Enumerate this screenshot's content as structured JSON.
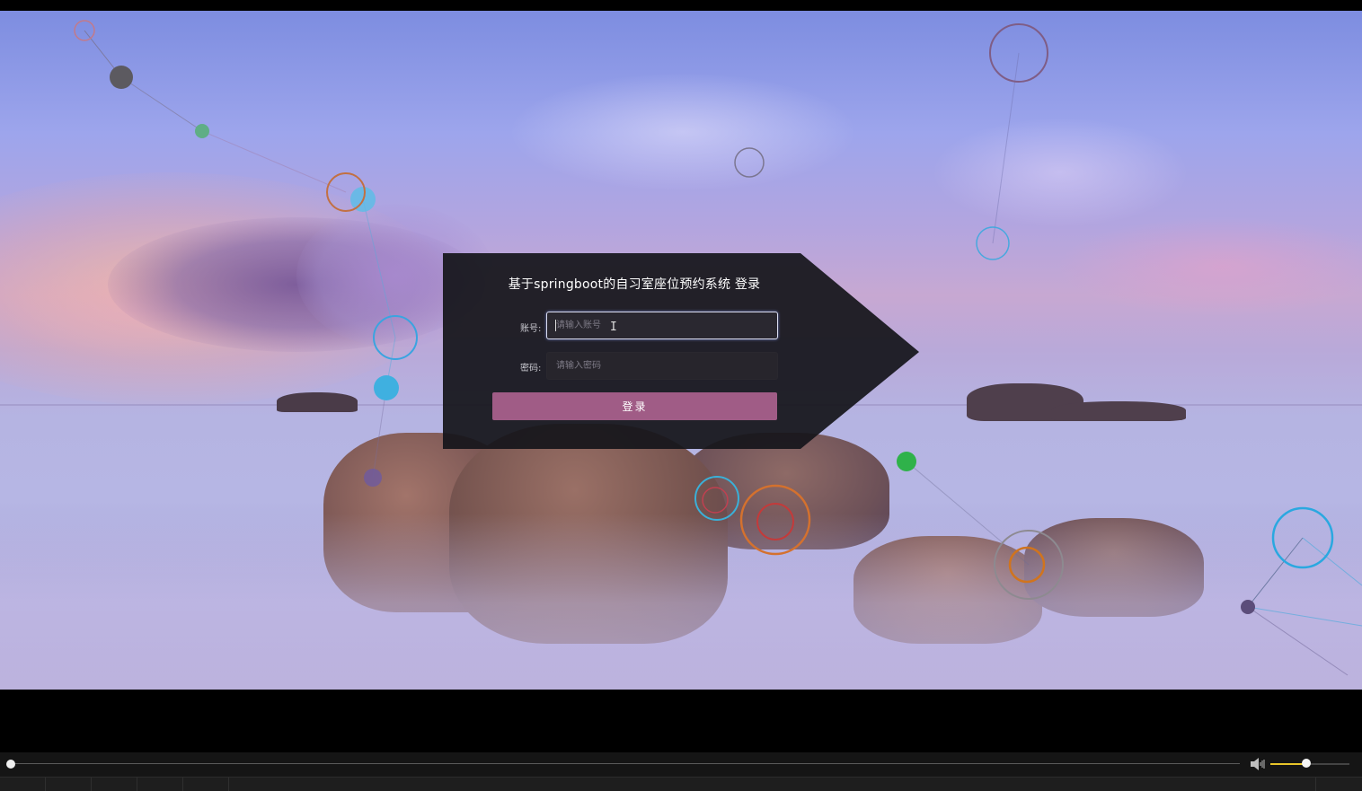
{
  "login": {
    "title": "基于springboot的自习室座位预约系统 登录",
    "account_label": "账号:",
    "account_placeholder": "请输入账号",
    "account_value": "",
    "password_label": "密码:",
    "password_placeholder": "请输入密码",
    "password_value": "",
    "submit_label": "登录"
  },
  "player": {
    "playback_progress": 0.0,
    "volume_level": 0.45,
    "volume_icon": "speaker-icon",
    "seek_thumb_color": "#f0f0f0",
    "volume_fill_color": "#e8c52a"
  },
  "colors": {
    "login_button": "#a05c86",
    "panel_background": "#1f1d24"
  }
}
